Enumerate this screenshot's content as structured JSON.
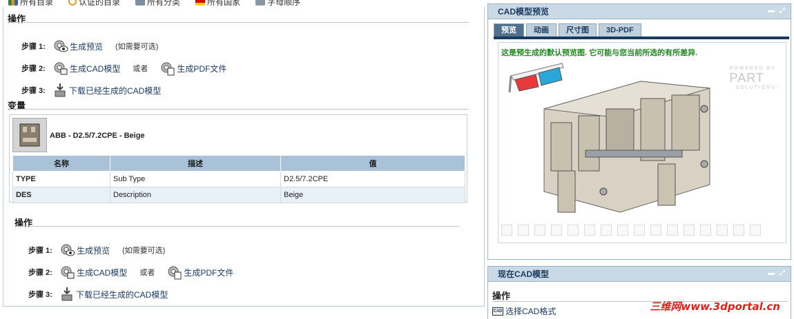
{
  "nav": [
    {
      "label": "所有目录",
      "icon": "books-icon"
    },
    {
      "label": "认证的目录",
      "icon": "certified-icon"
    },
    {
      "label": "所有分类",
      "icon": "category-icon"
    },
    {
      "label": "所有国家",
      "icon": "flag-icon"
    },
    {
      "label": "字母顺序",
      "icon": "alphabet-icon"
    }
  ],
  "left": {
    "ops_title": "操作",
    "steps1": {
      "s1_label": "步骤 1:",
      "s1_action": "生成预览",
      "s1_note": "(如需要可选)",
      "s2_label": "步骤 2:",
      "s2_action": "生成CAD模型",
      "s2_or": "或者",
      "s2_action2": "生成PDF文件",
      "s3_label": "步骤 3:",
      "s3_action": "下载已经生成的CAD模型"
    },
    "variants_title": "变量",
    "variant_name": "ABB - D2.5/7.2CPE - Beige",
    "table": {
      "headers": [
        "名称",
        "描述",
        "值"
      ],
      "rows": [
        [
          "TYPE",
          "Sub Type",
          "D2.5/7.2CPE"
        ],
        [
          "DES",
          "Description",
          "Beige"
        ]
      ]
    },
    "ops_title2": "操作",
    "steps2": {
      "s1_label": "步骤 1:",
      "s1_action": "生成预览",
      "s1_note": "(如需要可选)",
      "s2_label": "步骤 2:",
      "s2_action": "生成CAD模型",
      "s2_or": "或者",
      "s2_action2": "生成PDF文件",
      "s3_label": "步骤 3:",
      "s3_action": "下载已经生成的CAD模型"
    }
  },
  "preview": {
    "title": "CAD模型预览",
    "tabs": [
      "预览",
      "动画",
      "尺寸图",
      "3D-PDF"
    ],
    "active_tab": "预览",
    "message": "这是预生成的默认预览图. 它可能与您当前所选的有所差异.",
    "watermark_top": "POWERED BY",
    "watermark_brand": "PART",
    "watermark_sub": "SOLUTIONS"
  },
  "current": {
    "title": "现在CAD模型",
    "ops_title": "操作",
    "select_format": "选择CAD格式",
    "cad_icon_text": "CAD"
  },
  "site_watermark": "三维网www.3dportal.cn",
  "colors": {
    "link": "#1a3a66",
    "header_bg": "#c9d9e6",
    "tab_active": "#4f6f8f",
    "message_green": "#1f8a1f",
    "table_header": "#a9c2d8"
  }
}
